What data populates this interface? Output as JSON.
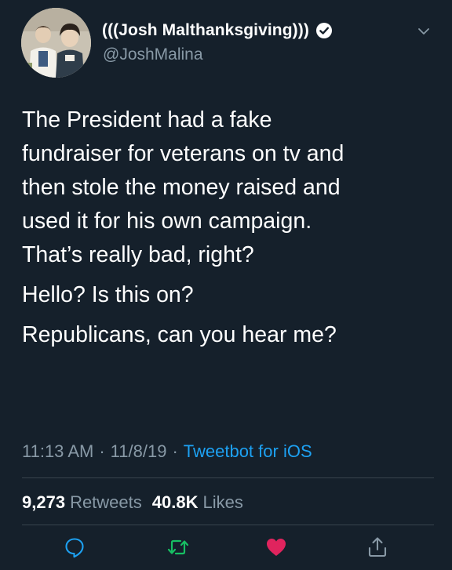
{
  "author": {
    "display_name": "(((Josh Malthanksgiving)))",
    "handle": "@JoshMalina",
    "verified": true
  },
  "tweet": {
    "paragraphs": [
      "The President had a fake",
      "fundraiser for veterans on tv and",
      "then stole the money raised and",
      "used it for his own campaign.",
      "That’s really bad, right?",
      "Hello? Is this on?",
      "Republicans, can you hear me?"
    ]
  },
  "meta": {
    "time": "11:13 AM",
    "date": "11/8/19",
    "separator": "·",
    "source": "Tweetbot for iOS"
  },
  "stats": {
    "retweets_count": "9,273",
    "retweets_label": "Retweets",
    "likes_count": "40.8K",
    "likes_label": "Likes"
  },
  "actions": {
    "reply_icon": "reply-icon",
    "retweet_icon": "retweet-icon",
    "like_icon": "heart-icon",
    "share_icon": "share-icon"
  },
  "colors": {
    "background": "#15202b",
    "text": "#ffffff",
    "secondary": "#8899a6",
    "link": "#1da1f2",
    "retweet": "#17bf63",
    "like": "#e0245e",
    "divider": "#38444d"
  }
}
